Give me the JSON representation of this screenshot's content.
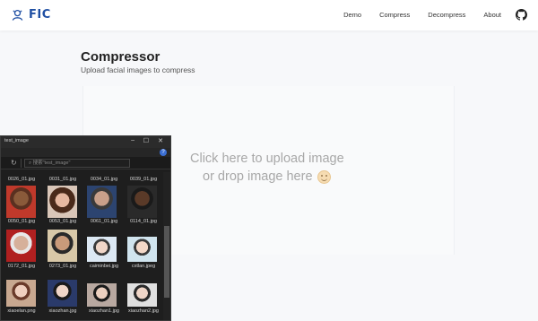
{
  "brand": {
    "name": "FIC",
    "logo_icon": "avatar-logo-icon",
    "color": "#1f4fa3"
  },
  "nav": {
    "links": [
      "Demo",
      "Compress",
      "Decompress",
      "About"
    ],
    "github_icon": "github-icon"
  },
  "page": {
    "title": "Compressor",
    "subtitle": "Upload facial images to compress"
  },
  "dropzone": {
    "line1": "Click here to upload image",
    "line2": "or drop image here",
    "emoji_icon": "smile-icon"
  },
  "explorer": {
    "title": "test_image",
    "search_placeholder": "搜索\"test_image\"",
    "top_labels": [
      "0026_01.jpg",
      "0031_01.jpg",
      "0034_01.jpg",
      "0039_01.jpg"
    ],
    "rows": [
      [
        "0050_01.jpg",
        "0053_01.jpg",
        "0061_01.jpg",
        "0114_01.jpg"
      ],
      [
        "0172_01.jpg",
        "0273_01.jpg",
        "caiminbei.jpg",
        "cxtlan.jpeg"
      ],
      [
        "xiaoelan.png",
        "xiaozhan.jpg",
        "xiaozhan1.jpg",
        "xiaozhan2.jpg"
      ]
    ]
  }
}
